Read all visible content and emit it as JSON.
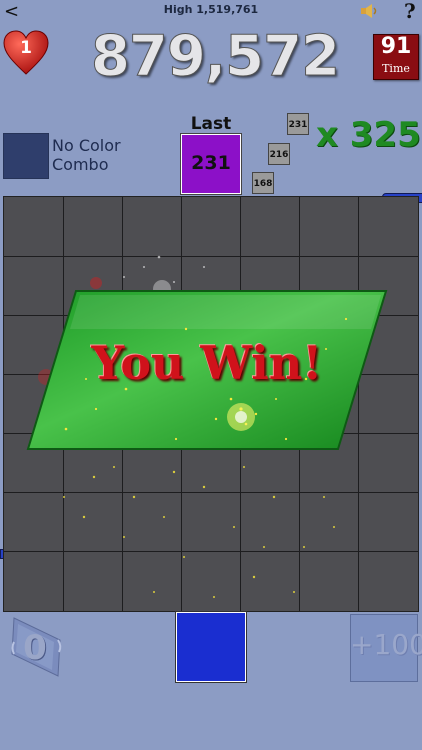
{
  "header": {
    "back_glyph": "<",
    "high_score": "High 1,519,761",
    "help_glyph": "?",
    "sound_icon": "speaker-icon"
  },
  "lives": {
    "count": "1",
    "icon": "heart-icon",
    "color": "#d01818"
  },
  "score": "879,572",
  "timer": {
    "value": "91",
    "label": "Time"
  },
  "combo": {
    "line1": "No Color",
    "line2": "Combo",
    "swatch_color": "#2f3e6c"
  },
  "last": {
    "label": "Last",
    "value": "231",
    "color": "#8c10c8"
  },
  "recent_tiles": [
    "231",
    "216",
    "168"
  ],
  "multiplier": "x 325",
  "board": {
    "rows": 7,
    "cols": 7,
    "color": "#4e4e52"
  },
  "banner": {
    "text": "You Win!",
    "color": "#1fa12a"
  },
  "controls": {
    "rotate_value": "0",
    "rotate_icon": "rotate-icon",
    "current_tile_color": "#1a2ed0",
    "bonus_label": "+100"
  }
}
